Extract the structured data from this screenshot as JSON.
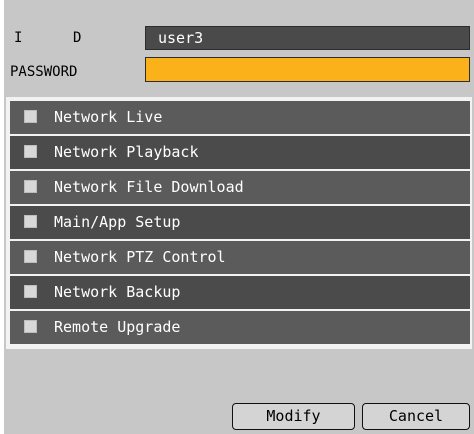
{
  "login": {
    "id_label": "I      D",
    "id_value": "user3",
    "password_label": "PASSWORD",
    "password_value": ""
  },
  "permissions": [
    {
      "label": "Network Live",
      "checked": false
    },
    {
      "label": "Network Playback",
      "checked": false
    },
    {
      "label": "Network File Download",
      "checked": false
    },
    {
      "label": "Main/App Setup",
      "checked": false
    },
    {
      "label": "Network PTZ Control",
      "checked": false
    },
    {
      "label": "Network Backup",
      "checked": false
    },
    {
      "label": "Remote Upgrade",
      "checked": false
    }
  ],
  "buttons": {
    "modify": "Modify",
    "cancel": "Cancel"
  },
  "colors": {
    "password_field": "#fbb11a",
    "panel": "#c7c7c7",
    "row_dark": "#4b4b4b",
    "row_light": "#5b5b5b"
  }
}
